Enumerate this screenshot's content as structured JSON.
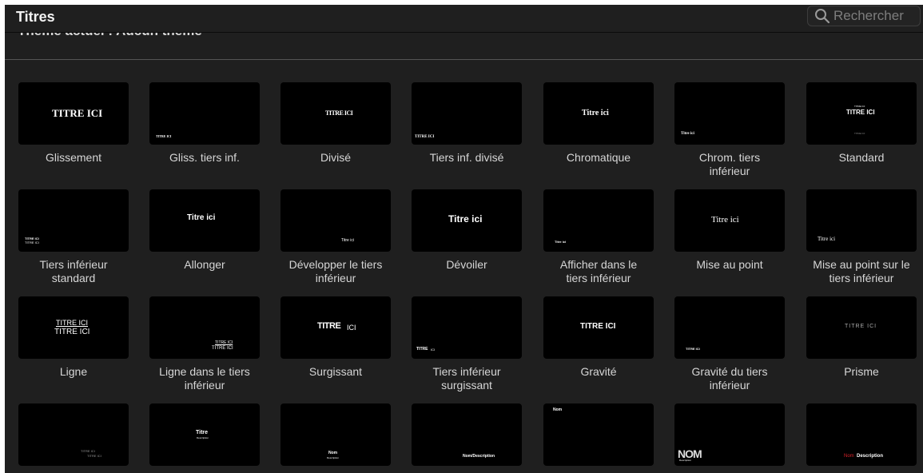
{
  "window": {
    "title": "Titres"
  },
  "search": {
    "placeholder": "Rechercher"
  },
  "theme": {
    "label": "Thème actuel : Aucun thème"
  },
  "tiles": [
    {
      "label": "Glissement",
      "thumb": [
        "TITRE ICI"
      ]
    },
    {
      "label": "Gliss. tiers inf.",
      "thumb": [
        "TITRE ICI"
      ]
    },
    {
      "label": "Divisé",
      "thumb": [
        "TITRE ICI"
      ]
    },
    {
      "label": "Tiers inf. divisé",
      "thumb": [
        "TITRE ICI"
      ]
    },
    {
      "label": "Chromatique",
      "thumb": [
        "Titre ici"
      ]
    },
    {
      "label": "Chrom. tiers\ninférieur",
      "thumb": [
        "Titre ici"
      ]
    },
    {
      "label": "Standard",
      "thumb": [
        "TITRE ICI",
        "TITRE ICI",
        "TITRE ICI"
      ]
    },
    {
      "label": "Tiers inférieur\nstandard",
      "thumb": [
        "TITRE ICI",
        "TITRE ICI"
      ]
    },
    {
      "label": "Allonger",
      "thumb": [
        "Titre ici"
      ]
    },
    {
      "label": "Développer le tiers\ninférieur",
      "thumb": [
        "Titre ici"
      ]
    },
    {
      "label": "Dévoiler",
      "thumb": [
        "Titre ici"
      ]
    },
    {
      "label": "Afficher dans le\ntiers inférieur",
      "thumb": [
        "Titre ici"
      ]
    },
    {
      "label": "Mise au point",
      "thumb": [
        "Titre ici"
      ]
    },
    {
      "label": "Mise au point sur le\ntiers inférieur",
      "thumb": [
        "Titre ici"
      ]
    },
    {
      "label": "Ligne",
      "thumb": [
        "TITRE ICI",
        "TITRE ICI"
      ]
    },
    {
      "label": "Ligne dans le tiers\ninférieur",
      "thumb": [
        "TITRE ICI",
        "TITRE ICI"
      ]
    },
    {
      "label": "Surgissant",
      "thumb": [
        "TITRE",
        "ICI"
      ]
    },
    {
      "label": "Tiers inférieur\nsurgissant",
      "thumb": [
        "TITRE",
        "ICI"
      ]
    },
    {
      "label": "Gravité",
      "thumb": [
        "TITRE ICI"
      ]
    },
    {
      "label": "Gravité du tiers\ninférieur",
      "thumb": [
        "TITRE ICI"
      ]
    },
    {
      "label": "Prisme",
      "thumb": [
        "TITRE ICI"
      ]
    },
    {
      "label": "",
      "thumb": [
        "TITRE ICI",
        "TITRE ICI"
      ]
    },
    {
      "label": "",
      "thumb": [
        "Titre",
        "Description"
      ]
    },
    {
      "label": "",
      "thumb": [
        "Nom",
        "Description"
      ]
    },
    {
      "label": "",
      "thumb": [
        "Nom/Description"
      ]
    },
    {
      "label": "",
      "thumb": [
        "Nom"
      ]
    },
    {
      "label": "",
      "thumb": [
        "NOM",
        "Description"
      ]
    },
    {
      "label": "",
      "thumb": [
        "Nom",
        "Description"
      ]
    }
  ],
  "colors": {
    "background": "#1f1f1f",
    "thumbnail": "#000000",
    "caption": "#d6d6d6",
    "accent_red": "#d8222a"
  }
}
